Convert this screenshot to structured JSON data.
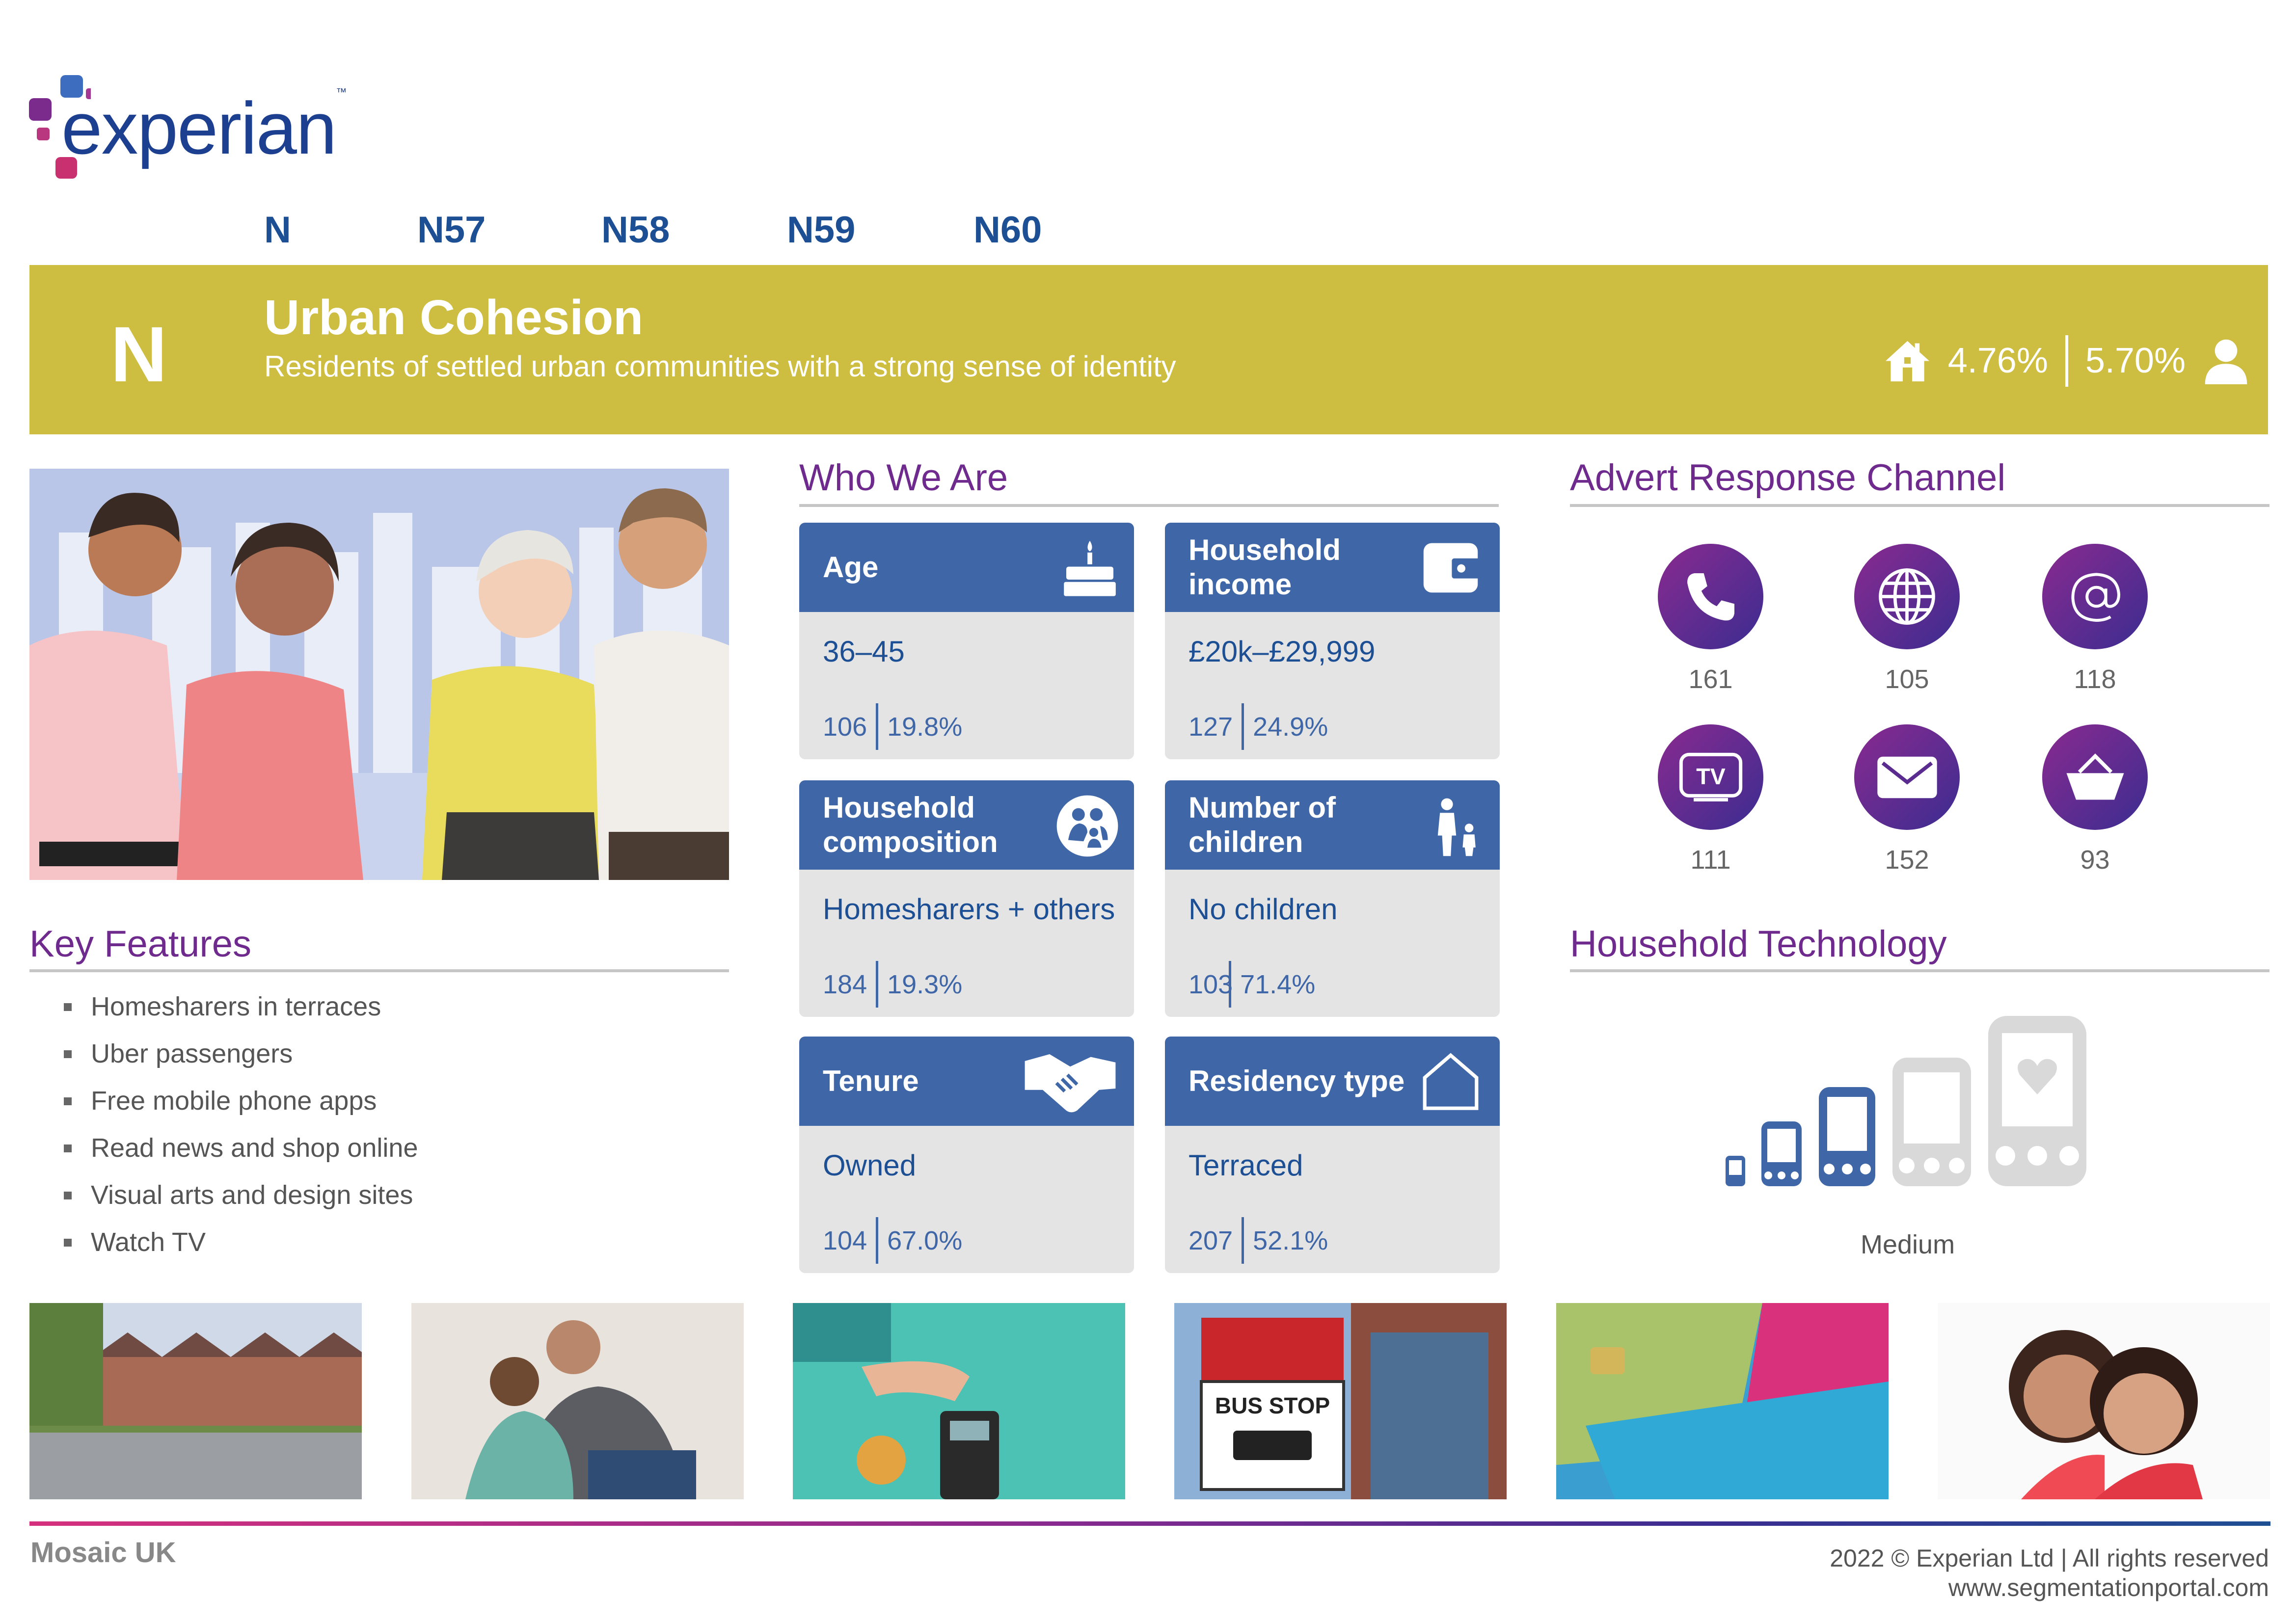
{
  "logo": {
    "text": "experian",
    "tm": "™"
  },
  "nav": [
    "N",
    "N57",
    "N58",
    "N59",
    "N60"
  ],
  "banner": {
    "letter": "N",
    "title": "Urban Cohesion",
    "subtitle": "Residents of settled urban communities with a strong sense of identity",
    "households_pct": "4.76%",
    "people_pct": "5.70%",
    "colors": {
      "banner": "#cdbd41",
      "text": "#ffffff"
    }
  },
  "key_features": {
    "title": "Key Features",
    "items": [
      "Homesharers in terraces",
      "Uber passengers",
      "Free mobile phone apps",
      "Read news and shop online",
      "Visual arts and design sites",
      "Watch TV"
    ]
  },
  "who_we_are": {
    "title": "Who We Are",
    "cards": [
      {
        "label": "Age",
        "icon": "birthday-cake-icon",
        "value": "36–45",
        "index": "106",
        "pct": "19.8%"
      },
      {
        "label": "Household income",
        "icon": "wallet-icon",
        "value": "£20k–£29,999",
        "index": "127",
        "pct": "24.9%"
      },
      {
        "label": "Household composition",
        "icon": "family-icon",
        "value": "Homesharers + others",
        "index": "184",
        "pct": "19.3%"
      },
      {
        "label": "Number of children",
        "icon": "parent-child-icon",
        "value": "No children",
        "index": "103",
        "pct": "71.4%"
      },
      {
        "label": "Tenure",
        "icon": "handshake-icon",
        "value": "Owned",
        "index": "104",
        "pct": "67.0%"
      },
      {
        "label": "Residency type",
        "icon": "house-outline-icon",
        "value": "Terraced",
        "index": "207",
        "pct": "52.1%"
      }
    ]
  },
  "advert_response": {
    "title": "Advert Response Channel",
    "channels": [
      {
        "icon": "phone-icon",
        "value": "161"
      },
      {
        "icon": "globe-icon",
        "value": "105"
      },
      {
        "icon": "email-at-icon",
        "value": "118"
      },
      {
        "icon": "tv-icon",
        "value": "111"
      },
      {
        "icon": "mail-envelope-icon",
        "value": "152"
      },
      {
        "icon": "shopping-basket-icon",
        "value": "93"
      }
    ]
  },
  "household_technology": {
    "title": "Household Technology",
    "level": "Medium",
    "filled_devices": 3,
    "total_devices": 5
  },
  "footer": {
    "left": "Mosaic UK",
    "copyright": "2022 © Experian Ltd | All rights reserved",
    "url": "www.segmentationportal.com"
  }
}
